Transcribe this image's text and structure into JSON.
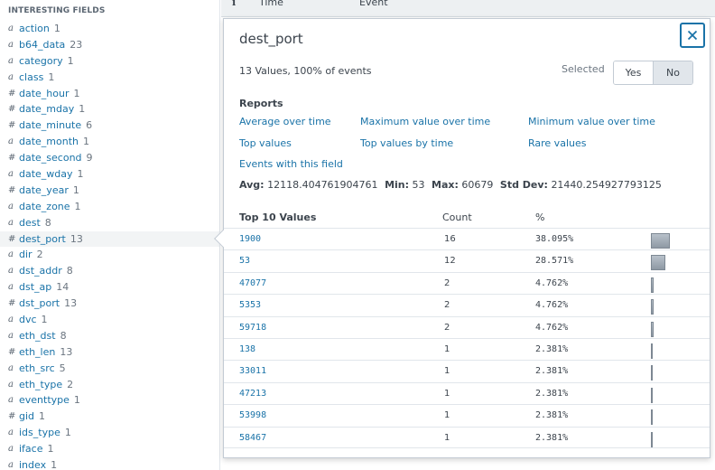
{
  "sidebar": {
    "heading": "INTERESTING FIELDS",
    "fields": [
      {
        "type": "a",
        "name": "action",
        "count": "1"
      },
      {
        "type": "a",
        "name": "b64_data",
        "count": "23"
      },
      {
        "type": "a",
        "name": "category",
        "count": "1"
      },
      {
        "type": "a",
        "name": "class",
        "count": "1"
      },
      {
        "type": "#",
        "name": "date_hour",
        "count": "1"
      },
      {
        "type": "#",
        "name": "date_mday",
        "count": "1"
      },
      {
        "type": "#",
        "name": "date_minute",
        "count": "6"
      },
      {
        "type": "a",
        "name": "date_month",
        "count": "1"
      },
      {
        "type": "#",
        "name": "date_second",
        "count": "9"
      },
      {
        "type": "a",
        "name": "date_wday",
        "count": "1"
      },
      {
        "type": "#",
        "name": "date_year",
        "count": "1"
      },
      {
        "type": "a",
        "name": "date_zone",
        "count": "1"
      },
      {
        "type": "a",
        "name": "dest",
        "count": "8"
      },
      {
        "type": "#",
        "name": "dest_port",
        "count": "13",
        "active": true
      },
      {
        "type": "a",
        "name": "dir",
        "count": "2"
      },
      {
        "type": "a",
        "name": "dst_addr",
        "count": "8"
      },
      {
        "type": "a",
        "name": "dst_ap",
        "count": "14"
      },
      {
        "type": "#",
        "name": "dst_port",
        "count": "13"
      },
      {
        "type": "a",
        "name": "dvc",
        "count": "1"
      },
      {
        "type": "a",
        "name": "eth_dst",
        "count": "8"
      },
      {
        "type": "#",
        "name": "eth_len",
        "count": "13"
      },
      {
        "type": "a",
        "name": "eth_src",
        "count": "5"
      },
      {
        "type": "a",
        "name": "eth_type",
        "count": "2"
      },
      {
        "type": "a",
        "name": "eventtype",
        "count": "1"
      },
      {
        "type": "#",
        "name": "gid",
        "count": "1"
      },
      {
        "type": "a",
        "name": "ids_type",
        "count": "1"
      },
      {
        "type": "a",
        "name": "iface",
        "count": "1"
      },
      {
        "type": "a",
        "name": "index",
        "count": "1"
      }
    ]
  },
  "events_header": {
    "info": "i",
    "time": "Time",
    "event": "Event"
  },
  "popup": {
    "title": "dest_port",
    "close_icon": "close-icon",
    "summary": "13 Values, 100% of events",
    "selected_label": "Selected",
    "toggle": {
      "yes": "Yes",
      "no": "No",
      "selected": "No"
    },
    "reports_heading": "Reports",
    "reports": {
      "avg_over_time": "Average over time",
      "max_over_time": "Maximum value over time",
      "min_over_time": "Minimum value over time",
      "top_values": "Top values",
      "top_by_time": "Top values by time",
      "rare_values": "Rare values",
      "events_with_field": "Events with this field"
    },
    "stats": {
      "avg_label": "Avg:",
      "avg": "12118.404761904761",
      "min_label": "Min:",
      "min": "53",
      "max_label": "Max:",
      "max": "60679",
      "stddev_label": "Std Dev:",
      "stddev": "21440.254927793125"
    },
    "table": {
      "headers": {
        "value": "Top 10 Values",
        "count": "Count",
        "percent": "%"
      },
      "rows": [
        {
          "value": "1900",
          "count": "16",
          "percent": "38.095%",
          "fraction": 0.38095
        },
        {
          "value": "53",
          "count": "12",
          "percent": "28.571%",
          "fraction": 0.28571
        },
        {
          "value": "47077",
          "count": "2",
          "percent": "4.762%",
          "fraction": 0.04762
        },
        {
          "value": "5353",
          "count": "2",
          "percent": "4.762%",
          "fraction": 0.04762
        },
        {
          "value": "59718",
          "count": "2",
          "percent": "4.762%",
          "fraction": 0.04762
        },
        {
          "value": "138",
          "count": "1",
          "percent": "2.381%",
          "fraction": 0.02381
        },
        {
          "value": "33011",
          "count": "1",
          "percent": "2.381%",
          "fraction": 0.02381
        },
        {
          "value": "47213",
          "count": "1",
          "percent": "2.381%",
          "fraction": 0.02381
        },
        {
          "value": "53998",
          "count": "1",
          "percent": "2.381%",
          "fraction": 0.02381
        },
        {
          "value": "58467",
          "count": "1",
          "percent": "2.381%",
          "fraction": 0.02381
        }
      ]
    }
  }
}
